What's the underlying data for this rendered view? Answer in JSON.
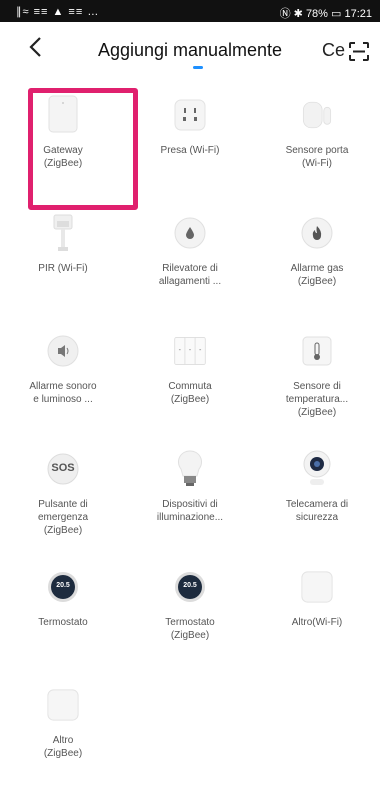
{
  "status_bar": {
    "left_icons": "∥≈ ≡≡ ▲ ≡≡ …",
    "right": "Ⓝ ✱ 78% ▭ 17:21"
  },
  "header": {
    "title": "Aggiungi manualmente",
    "trailing_tab": "Ce"
  },
  "devices": [
    {
      "label": "Gateway\n(ZigBee)",
      "icon": "gateway-icon"
    },
    {
      "label": "Presa (Wi-Fi)",
      "icon": "plug-icon"
    },
    {
      "label": "Sensore porta\n(Wi-Fi)",
      "icon": "door-sensor-icon"
    },
    {
      "label": "PIR (Wi-Fi)",
      "icon": "pir-icon"
    },
    {
      "label": "Rilevatore di\nallagamenti ...",
      "icon": "water-leak-icon"
    },
    {
      "label": "Allarme gas\n(ZigBee)",
      "icon": "gas-alarm-icon"
    },
    {
      "label": "Allarme sonoro\ne luminoso ...",
      "icon": "siren-icon"
    },
    {
      "label": "Commuta\n(ZigBee)",
      "icon": "switch-icon"
    },
    {
      "label": "Sensore di\ntemperatura...\n(ZigBee)",
      "icon": "temperature-sensor-icon"
    },
    {
      "label": "Pulsante di\nemergenza\n(ZigBee)",
      "icon": "sos-button-icon",
      "badge": "SOS"
    },
    {
      "label": "Dispositivi di\nilluminazione...",
      "icon": "bulb-icon"
    },
    {
      "label": "Telecamera di\nsicurezza",
      "icon": "camera-icon"
    },
    {
      "label": "Termostato",
      "icon": "thermostat-icon",
      "badge": "20.5"
    },
    {
      "label": "Termostato\n(ZigBee)",
      "icon": "thermostat-icon",
      "badge": "20.5"
    },
    {
      "label": "Altro(Wi-Fi)",
      "icon": "generic-device-icon"
    },
    {
      "label": "Altro\n(ZigBee)",
      "icon": "generic-device-icon"
    }
  ],
  "colors": {
    "highlight": "#e0206e",
    "accent": "#1e90ff"
  }
}
